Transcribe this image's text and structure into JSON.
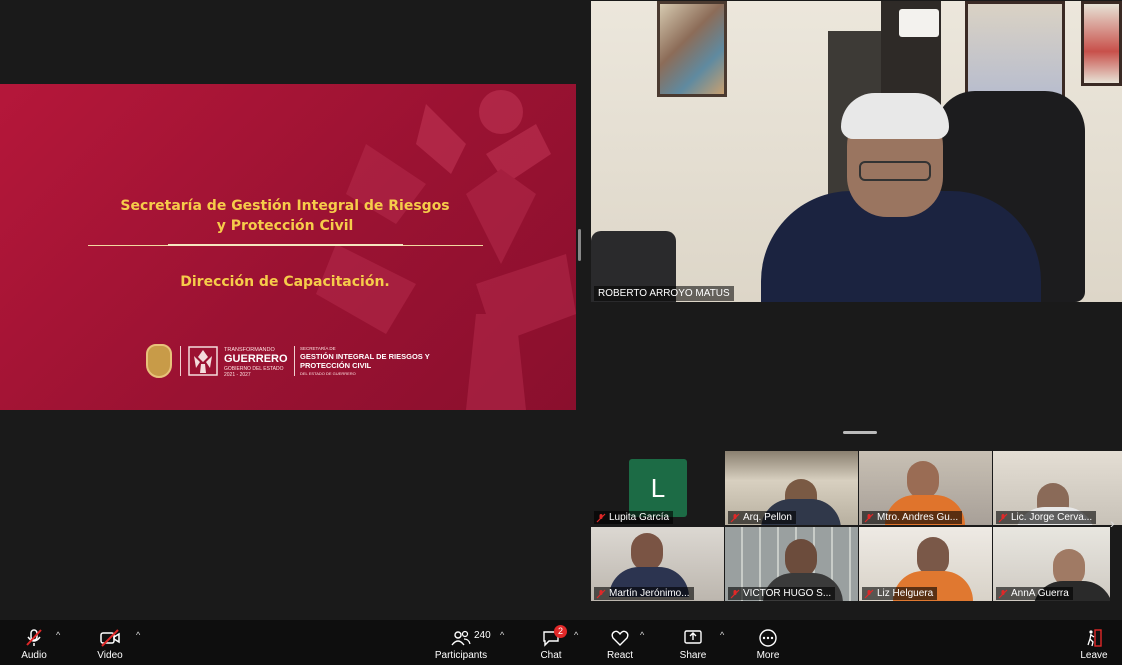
{
  "slide": {
    "title_line1": "Secretaría de Gestión Integral de Riesgos",
    "title_line2": "y Protección Civil",
    "subtitle": "Dirección de Capacitación.",
    "brand_small": "TRANSFORMANDO",
    "brand_big": "GUERRERO",
    "brand_sub1": "GOBIERNO DEL ESTADO",
    "brand_sub2": "2021 - 2027",
    "sec_small": "SECRETARÍA DE",
    "sec_big1": "GESTIÓN INTEGRAL DE RIESGOS Y",
    "sec_big2": "PROTECCIÓN CIVIL",
    "sec_foot": "DEL ESTADO DE GUERRERO"
  },
  "speaker": {
    "name": "ROBERTO ARROYO MATUS"
  },
  "gallery": [
    {
      "name": "Lupita García",
      "initial": "L",
      "muted": true
    },
    {
      "name": "Arq. Pellon",
      "muted": true
    },
    {
      "name": "Mtro. Andres Gu...",
      "muted": true
    },
    {
      "name": "Lic. Jorge Cerva...",
      "muted": true
    },
    {
      "name": "Martín Jerónimo...",
      "muted": true
    },
    {
      "name": "VICTOR HUGO S...",
      "muted": true
    },
    {
      "name": "Liz Helguera",
      "muted": true
    },
    {
      "name": "AnnA Guerra",
      "muted": true
    }
  ],
  "toolbar": {
    "audio": "Audio",
    "video": "Video",
    "participants": "Participants",
    "participants_count": "240",
    "chat": "Chat",
    "chat_badge": "2",
    "react": "React",
    "share": "Share",
    "more": "More",
    "leave": "Leave"
  },
  "colors": {
    "slide": "#9a1232",
    "gold": "#f6cc4a",
    "avatar": "#1c6b45",
    "muted": "#e02828"
  }
}
